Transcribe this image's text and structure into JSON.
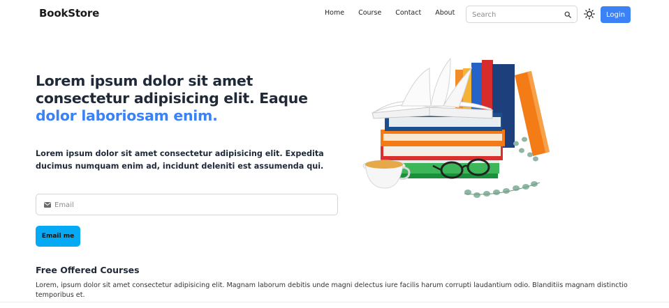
{
  "brand": "BookStore",
  "nav": {
    "links": [
      "Home",
      "Course",
      "Contact",
      "About"
    ],
    "search_placeholder": "Search",
    "login_label": "Login"
  },
  "hero": {
    "title_main": "Lorem ipsum dolor sit amet consectetur adipisicing elit. Eaque",
    "title_accent": "dolor laboriosam enim.",
    "subtitle": "Lorem ipsum dolor sit amet consectetur adipisicing elit. Expedita ducimus numquam enim ad, incidunt deleniti est assumenda qui.",
    "email_placeholder": "Email",
    "email_button": "Email me"
  },
  "courses": {
    "title": "Free Offered Courses",
    "description": "Lorem, ipsum dolor sit amet consectetur adipisicing elit. Magnam laborum debitis unde magni delectus iure facilis harum corrupti laudantium odio. Blanditiis magnam distinctio temporibus et."
  },
  "colors": {
    "accent": "#3b82f6",
    "button_cyan": "#06a9f4"
  },
  "icons": {
    "search": "search-icon",
    "theme": "sun-icon",
    "mail": "envelope-icon"
  }
}
